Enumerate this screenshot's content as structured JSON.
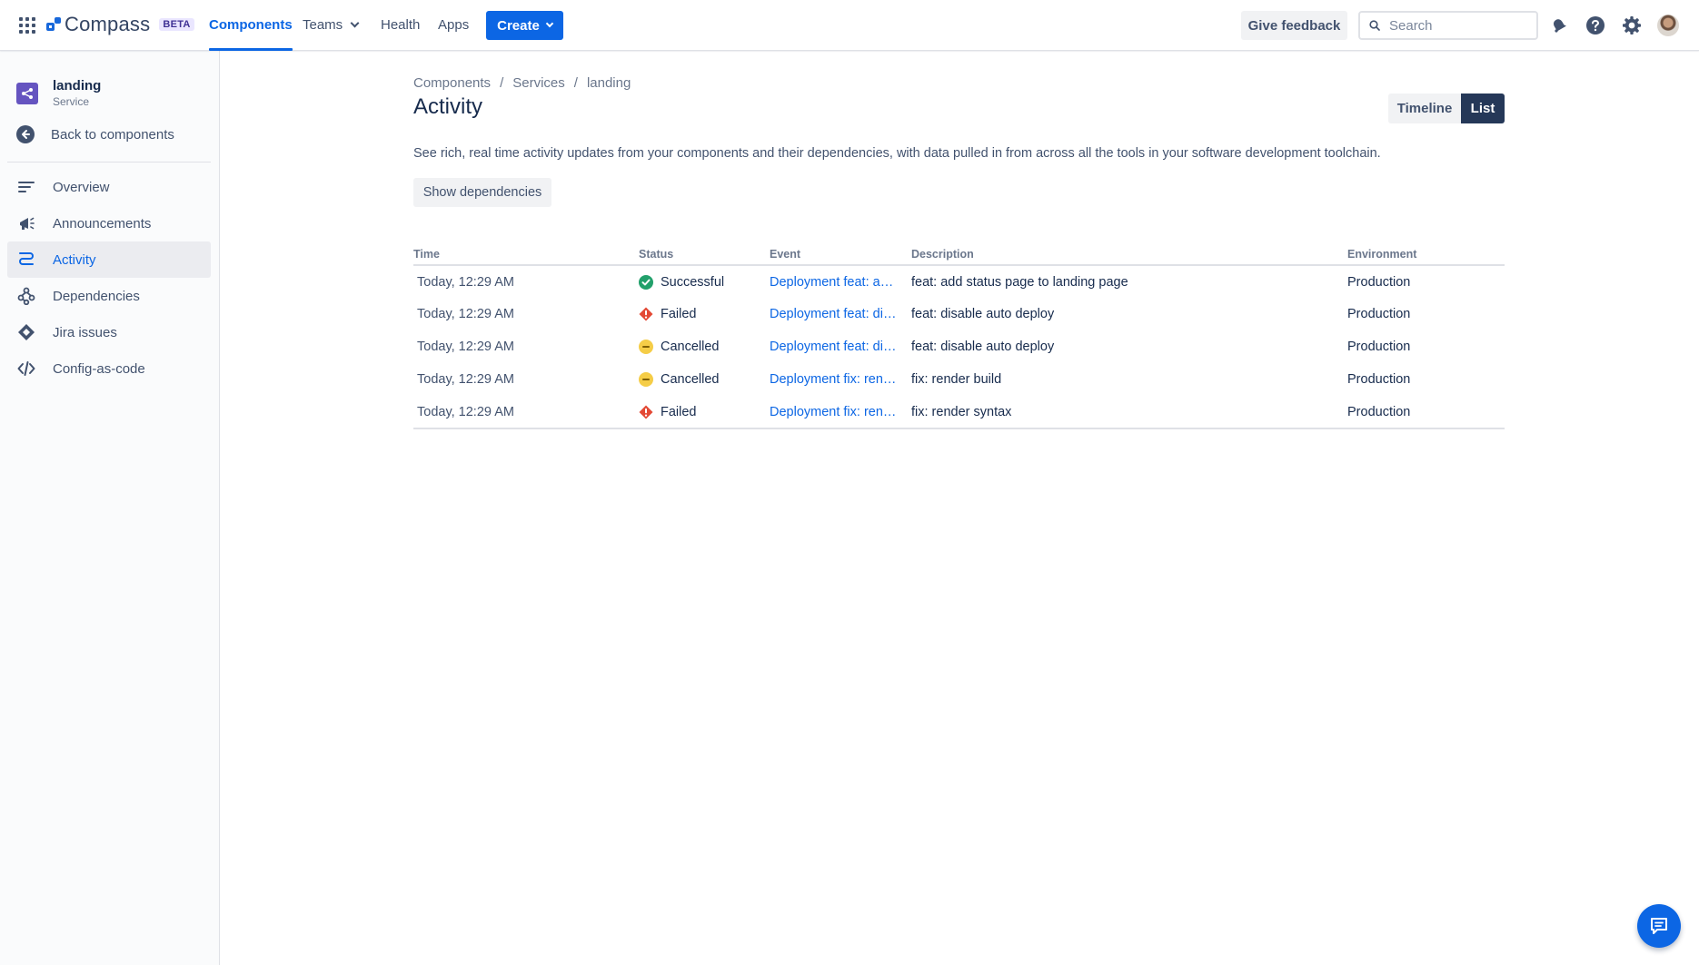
{
  "topnav": {
    "logo_text": "Compass",
    "beta_label": "BETA",
    "items": [
      {
        "label": "Components",
        "active": true
      },
      {
        "label": "Teams"
      },
      {
        "label": "Health"
      },
      {
        "label": "Apps"
      }
    ],
    "create_label": "Create",
    "feedback_label": "Give feedback",
    "search_placeholder": "Search",
    "icons": [
      "app-switcher-icon",
      "notifications-icon",
      "help-icon",
      "settings-icon",
      "avatar"
    ]
  },
  "sidebar": {
    "component_name": "landing",
    "component_type": "Service",
    "back_label": "Back to components",
    "items": [
      {
        "label": "Overview",
        "icon": "overview-icon"
      },
      {
        "label": "Announcements",
        "icon": "megaphone-icon"
      },
      {
        "label": "Activity",
        "icon": "activity-icon",
        "active": true
      },
      {
        "label": "Dependencies",
        "icon": "dependencies-icon"
      },
      {
        "label": "Jira issues",
        "icon": "jira-icon"
      },
      {
        "label": "Config-as-code",
        "icon": "code-icon"
      }
    ]
  },
  "main": {
    "breadcrumb": [
      "Components",
      "Services",
      "landing"
    ],
    "title": "Activity",
    "view_toggle": {
      "timeline": "Timeline",
      "list": "List",
      "selected": "List"
    },
    "description": "See rich, real time activity updates from your components and their dependencies, with data pulled in from across all the tools in your software development toolchain.",
    "show_dependencies_label": "Show dependencies",
    "table": {
      "headers": [
        "Time",
        "Status",
        "Event",
        "Description",
        "Environment"
      ],
      "rows": [
        {
          "time": "Today, 12:29 AM",
          "status": "Successful",
          "status_kind": "success",
          "event": "Deployment feat: add status page to landing page",
          "description": "feat: add status page to landing page",
          "environment": "Production"
        },
        {
          "time": "Today, 12:29 AM",
          "status": "Failed",
          "status_kind": "failed",
          "event": "Deployment feat: disable auto deploy",
          "description": "feat: disable auto deploy",
          "environment": "Production"
        },
        {
          "time": "Today, 12:29 AM",
          "status": "Cancelled",
          "status_kind": "cancelled",
          "event": "Deployment feat: disable auto deploy",
          "description": "feat: disable auto deploy",
          "environment": "Production"
        },
        {
          "time": "Today, 12:29 AM",
          "status": "Cancelled",
          "status_kind": "cancelled",
          "event": "Deployment fix: render build",
          "description": "fix: render build",
          "environment": "Production"
        },
        {
          "time": "Today, 12:29 AM",
          "status": "Failed",
          "status_kind": "failed",
          "event": "Deployment fix: render syntax",
          "description": "fix: render syntax",
          "environment": "Production"
        }
      ]
    }
  },
  "colors": {
    "accent": "#0c66e4",
    "success": "#22a06b",
    "failed": "#e34935",
    "cancelled": "#f5cd47",
    "component_icon": "#6554c0"
  }
}
